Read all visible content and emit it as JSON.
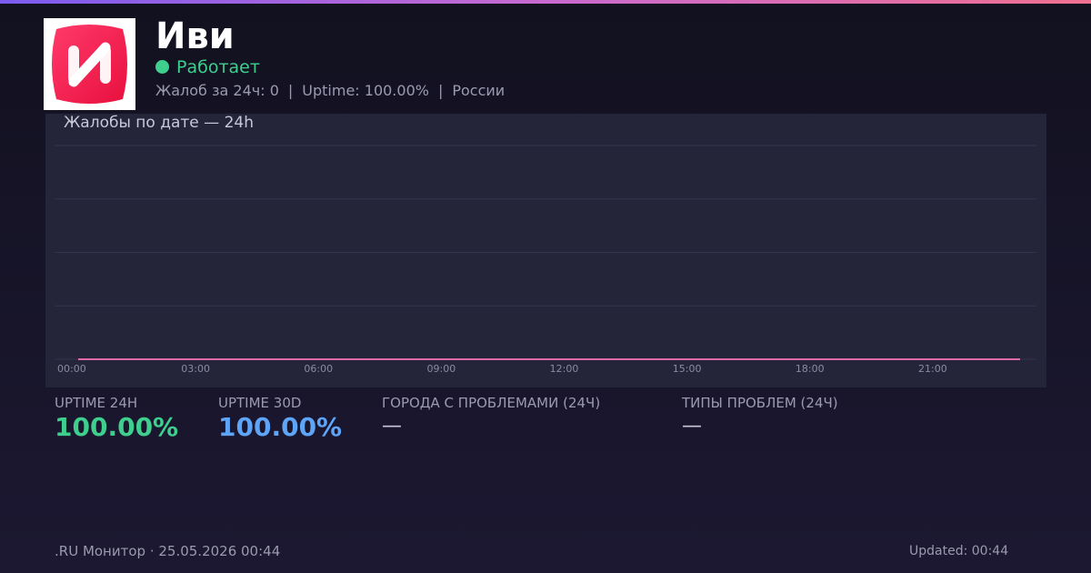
{
  "service": {
    "name": "Иви",
    "logo_icon": "ivi-logo-icon",
    "status_text": "Работает",
    "status_color": "#3ecf8e"
  },
  "meta": {
    "complaints": "Жалоб за 24ч: 0",
    "uptime": "Uptime: 100.00%",
    "region": "России",
    "separator": "|"
  },
  "chart_data": {
    "type": "line",
    "title": "Жалобы по дате — 24h",
    "x_ticks": [
      "00:00",
      "03:00",
      "06:00",
      "09:00",
      "12:00",
      "15:00",
      "18:00",
      "21:00"
    ],
    "x": [
      "00:00",
      "01:00",
      "02:00",
      "03:00",
      "04:00",
      "05:00",
      "06:00",
      "07:00",
      "08:00",
      "09:00",
      "10:00",
      "11:00",
      "12:00",
      "13:00",
      "14:00",
      "15:00",
      "16:00",
      "17:00",
      "18:00",
      "19:00",
      "20:00",
      "21:00",
      "22:00",
      "23:00"
    ],
    "series": [
      {
        "values": [
          0,
          0,
          0,
          0,
          0,
          0,
          0,
          0,
          0,
          0,
          0,
          0,
          0,
          0,
          0,
          0,
          0,
          0,
          0,
          0,
          0,
          0,
          0,
          0
        ],
        "color": "#e06aa8"
      }
    ],
    "ylim": [
      0,
      4
    ],
    "grid": true,
    "legend": "none"
  },
  "stats": {
    "uptime_24h": {
      "label": "UPTIME 24H",
      "value": "100.00%",
      "color": "#3ecf8e"
    },
    "uptime_30d": {
      "label": "UPTIME 30D",
      "value": "100.00%",
      "color": "#5ea4f7"
    },
    "cities": {
      "label": "ГОРОДА С ПРОБЛЕМАМИ (24Ч)",
      "value": "—"
    },
    "types": {
      "label": "ТИПЫ ПРОБЛЕМ (24Ч)",
      "value": "—"
    }
  },
  "footer": {
    "left": ".RU Монитор · 25.05.2026 00:44",
    "right": "Updated: 00:44"
  },
  "colors": {
    "accent_gradient": [
      "#7b5cf0",
      "#f07090"
    ],
    "logo_red": "#f0184a"
  }
}
